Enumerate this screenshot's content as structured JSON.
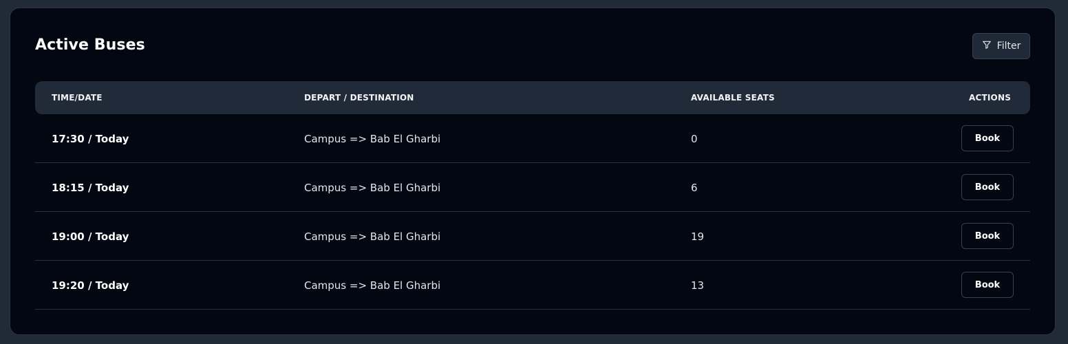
{
  "card": {
    "title": "Active Buses",
    "filter_label": "Filter",
    "filter_icon": "filter-icon"
  },
  "table": {
    "headers": [
      "TIME/DATE",
      "DEPART / DESTINATION",
      "AVAILABLE SEATS",
      "ACTIONS"
    ],
    "rows": [
      {
        "time": "17:30 / Today",
        "route": "Campus => Bab El Gharbi",
        "seats": "0",
        "action": "Book"
      },
      {
        "time": "18:15 / Today",
        "route": "Campus => Bab El Gharbi",
        "seats": "6",
        "action": "Book"
      },
      {
        "time": "19:00 / Today",
        "route": "Campus => Bab El Gharbi",
        "seats": "19",
        "action": "Book"
      },
      {
        "time": "19:20 / Today",
        "route": "Campus => Bab El Gharbi",
        "seats": "13",
        "action": "Book"
      }
    ]
  },
  "colors": {
    "page_bg": "#212a37",
    "card_bg": "#030712",
    "header_bg": "#202a38"
  }
}
